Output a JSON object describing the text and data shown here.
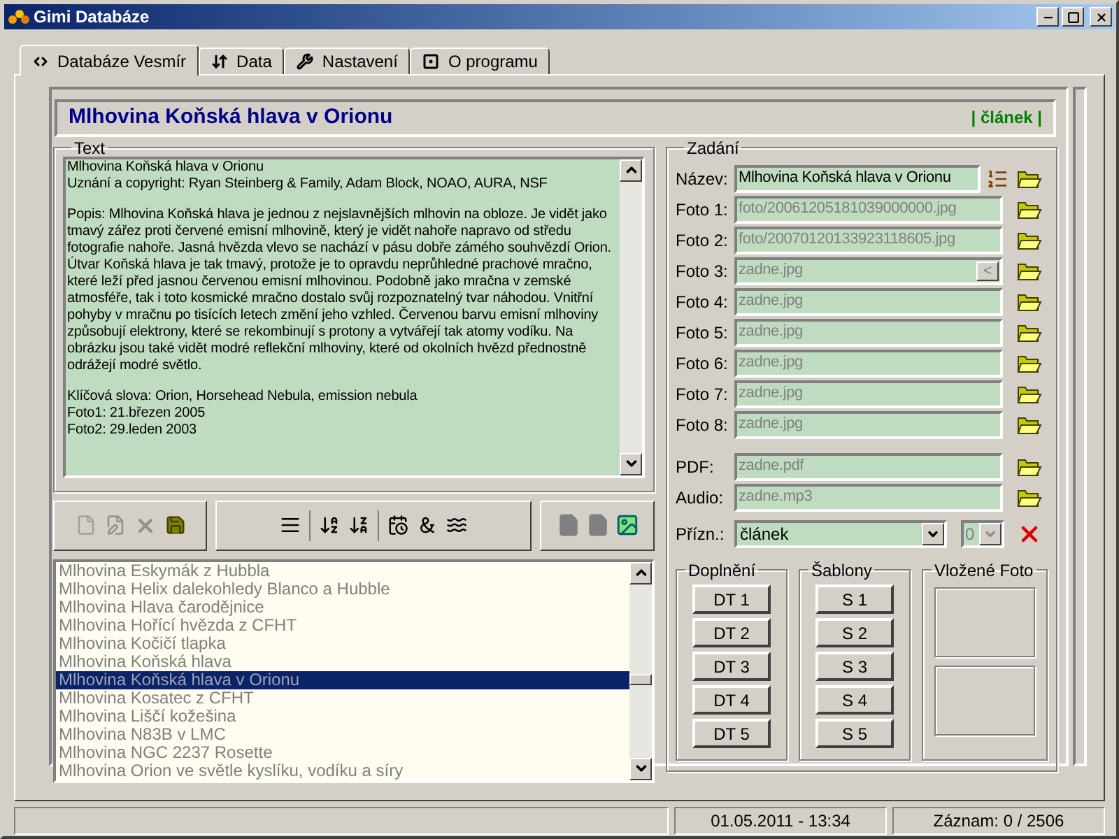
{
  "window": {
    "title": "Gimi Databáze"
  },
  "tabs": [
    {
      "label": "Databáze Vesmír",
      "selected": true,
      "kind": "database"
    },
    {
      "label": "Data",
      "selected": false,
      "kind": "data"
    },
    {
      "label": "Nastavení",
      "selected": false,
      "kind": "settings"
    },
    {
      "label": "O programu",
      "selected": false,
      "kind": "about"
    }
  ],
  "header": {
    "title": "Mlhovina Koňská hlava v Orionu",
    "tag": "| článek |"
  },
  "text_group": {
    "legend": "Text",
    "paragraphs": [
      [
        "Mlhovina Koňská hlava v Orionu",
        "Uznání a copyright: Ryan Steinberg & Family, Adam Block, NOAO, AURA, NSF"
      ],
      [
        "Popis: Mlhovina Koňská hlava je jednou z nejslavnějších mlhovin na obloze. Je vidět jako tmavý zářez proti červené emisní mlhovině, který je vidět nahoře napravo od středu fotografie nahoře. Jasná hvězda vlevo se nachází v pásu dobře zámého souhvězdí Orion. Útvar Koňská hlava je tak tmavý, protože je to opravdu neprůhledné prachové mračno, které leží před jasnou červenou emisní mlhovinou. Podobně jako mračna v zemské atmosféře, tak i toto kosmické mračno dostalo svůj rozpoznatelný tvar náhodou. Vnitřní pohyby v mračnu po tisících letech změní jeho vzhled. Červenou barvu emisní mlhoviny způsobují elektrony, které se rekombinují s protony a vytvářejí tak atomy vodíku. Na obrázku jsou také vidět modré reflekční mlhoviny, které od okolních hvězd přednostně odrážejí modré světlo."
      ],
      [
        "Klíčová slova: Orion, Horsehead Nebula, emission nebula",
        "Foto1: 21.březen 2005",
        "Foto2: 29.leden 2003"
      ]
    ]
  },
  "list": {
    "items": [
      {
        "label": "Mlhovina Eskymák z Hubbla",
        "selected": false
      },
      {
        "label": "Mlhovina Helix dalekohledy Blanco a Hubble",
        "selected": false
      },
      {
        "label": "Mlhovina Hlava čarodějnice",
        "selected": false
      },
      {
        "label": "Mlhovina Hořící hvězda z CFHT",
        "selected": false
      },
      {
        "label": "Mlhovina Kočičí tlapka",
        "selected": false
      },
      {
        "label": "Mlhovina Koňská hlava",
        "selected": false
      },
      {
        "label": "Mlhovina Koňská hlava v Orionu",
        "selected": true
      },
      {
        "label": "Mlhovina Kosatec z CFHT",
        "selected": false
      },
      {
        "label": "Mlhovina Liščí kožešina",
        "selected": false
      },
      {
        "label": "Mlhovina N83B v LMC",
        "selected": false
      },
      {
        "label": "Mlhovina NGC 2237 Rosette",
        "selected": false
      },
      {
        "label": "Mlhovina Orion ve světle kyslíku, vodíku a síry",
        "selected": false
      }
    ]
  },
  "entry": {
    "legend": "Zadání",
    "fields": [
      {
        "label": "Název:",
        "value": "Mlhovina Koňská hlava v Orionu",
        "kind": "title",
        "disabled": false
      },
      {
        "label": "Foto 1:",
        "value": "foto/20061205181039000000.jpg",
        "kind": "file",
        "disabled": true
      },
      {
        "label": "Foto 2:",
        "value": "foto/20070120133923118605.jpg",
        "kind": "file",
        "disabled": true
      },
      {
        "label": "Foto 3:",
        "value": "zadne.jpg",
        "kind": "file",
        "disabled": true,
        "button": "<"
      },
      {
        "label": "Foto 4:",
        "value": "zadne.jpg",
        "kind": "file",
        "disabled": true
      },
      {
        "label": "Foto 5:",
        "value": "zadne.jpg",
        "kind": "file",
        "disabled": true
      },
      {
        "label": "Foto 6:",
        "value": "zadne.jpg",
        "kind": "file",
        "disabled": true
      },
      {
        "label": "Foto 7:",
        "value": "zadne.jpg",
        "kind": "file",
        "disabled": true
      },
      {
        "label": "Foto 8:",
        "value": "zadne.jpg",
        "kind": "file",
        "disabled": true
      },
      {
        "label": "PDF:",
        "value": "zadne.pdf",
        "kind": "media",
        "disabled": true
      },
      {
        "label": "Audio:",
        "value": "zadne.mp3",
        "kind": "file",
        "disabled": true
      }
    ],
    "flag": {
      "label": "Přízn.:",
      "value": "článek",
      "number": "0"
    }
  },
  "doplneni": {
    "legend": "Doplnění",
    "buttons": [
      "DT 1",
      "DT 2",
      "DT 3",
      "DT 4",
      "DT 5"
    ]
  },
  "sablony": {
    "legend": "Šablony",
    "buttons": [
      "S 1",
      "S 2",
      "S 3",
      "S 4",
      "S 5"
    ]
  },
  "vlozene_foto": {
    "legend": "Vložené Foto"
  },
  "status_bar": {
    "datetime": "01.05.2011 - 13:34",
    "record": "Záznam: 0 / 2506"
  }
}
